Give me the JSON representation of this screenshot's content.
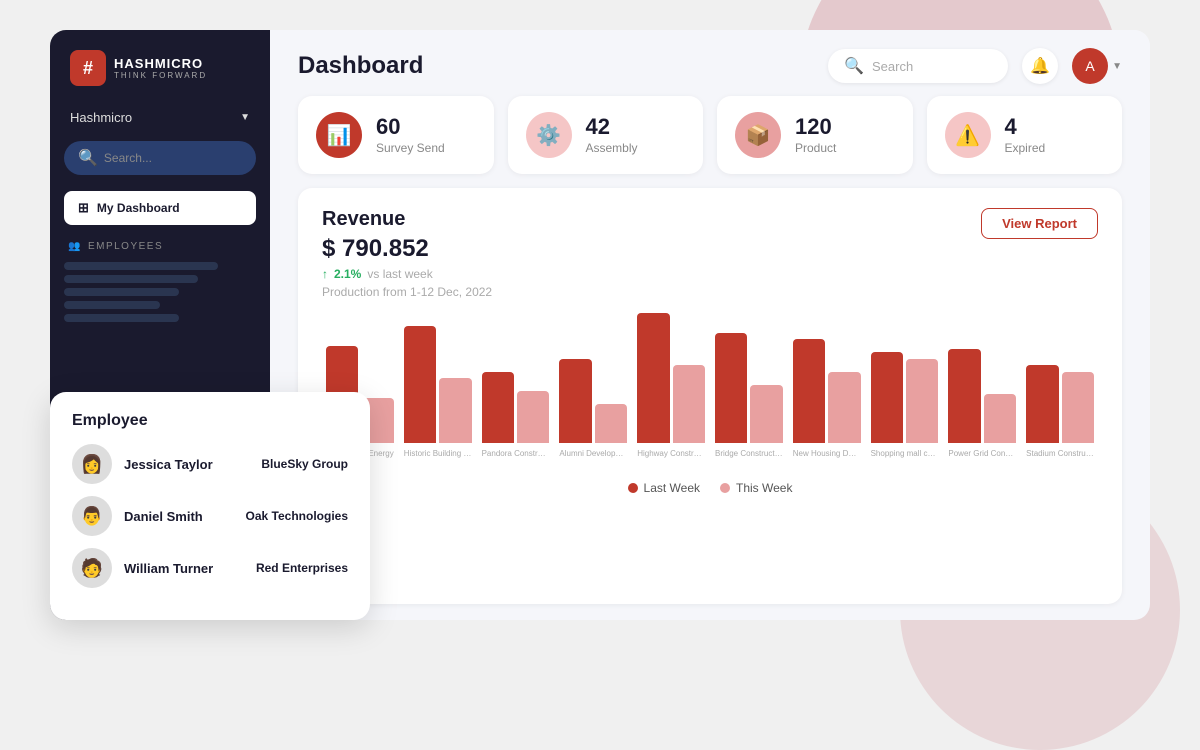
{
  "sidebar": {
    "logo_title": "HASHMICRO",
    "logo_sub": "THINK FORWARD",
    "brand_name": "Hashmicro",
    "search_placeholder": "Search...",
    "active_item_label": "My Dashboard",
    "section_label": "EMPLOYEES"
  },
  "topbar": {
    "title": "Dashboard",
    "search_placeholder": "Search",
    "notification_icon": "🔔",
    "avatar_text": "A"
  },
  "stat_cards": [
    {
      "number": "60",
      "label": "Survey Send",
      "icon": "📊",
      "icon_style": "red-dark"
    },
    {
      "number": "42",
      "label": "Assembly",
      "icon": "⚙️",
      "icon_style": "red-light"
    },
    {
      "number": "120",
      "label": "Product",
      "icon": "📦",
      "icon_style": "red-med"
    },
    {
      "number": "4",
      "label": "Expired",
      "icon": "⚠️",
      "icon_style": "red-light"
    }
  ],
  "revenue": {
    "title": "Revenue",
    "amount": "$ 790.852",
    "change_pct": "2.1%",
    "change_text": "vs last week",
    "period": "Production from 1-12 Dec, 2022",
    "view_report_btn": "View Report"
  },
  "chart": {
    "bars": [
      {
        "label": "Renewable\nEnergy",
        "last": 75,
        "this": 35
      },
      {
        "label": "Historic Building\nRefurbication",
        "last": 90,
        "this": 50
      },
      {
        "label": "Pandora\nConstructions",
        "last": 55,
        "this": 40
      },
      {
        "label": "Alumni\nDevelopment",
        "last": 65,
        "this": 30
      },
      {
        "label": "Highway\nConstruction",
        "last": 100,
        "this": 60
      },
      {
        "label": "Bridge\nConstruction",
        "last": 85,
        "this": 45
      },
      {
        "label": "New Housing\nDevelopment",
        "last": 80,
        "this": 55
      },
      {
        "label": "Shopping mall\nconstructions",
        "last": 70,
        "this": 65
      },
      {
        "label": "Power Grid\nConstruction",
        "last": 72,
        "this": 38
      },
      {
        "label": "Stadium\nConstruction",
        "last": 60,
        "this": 55
      }
    ],
    "legend_last_week": "Last Week",
    "legend_this_week": "This Week"
  },
  "employee_panel": {
    "title": "Employee",
    "employees": [
      {
        "name": "Jessica Taylor",
        "company": "BlueSky Group",
        "avatar": "👩"
      },
      {
        "name": "Daniel Smith",
        "company": "Oak Technologies",
        "avatar": "👨"
      },
      {
        "name": "William Turner",
        "company": "Red Enterprises",
        "avatar": "🧑"
      }
    ]
  }
}
